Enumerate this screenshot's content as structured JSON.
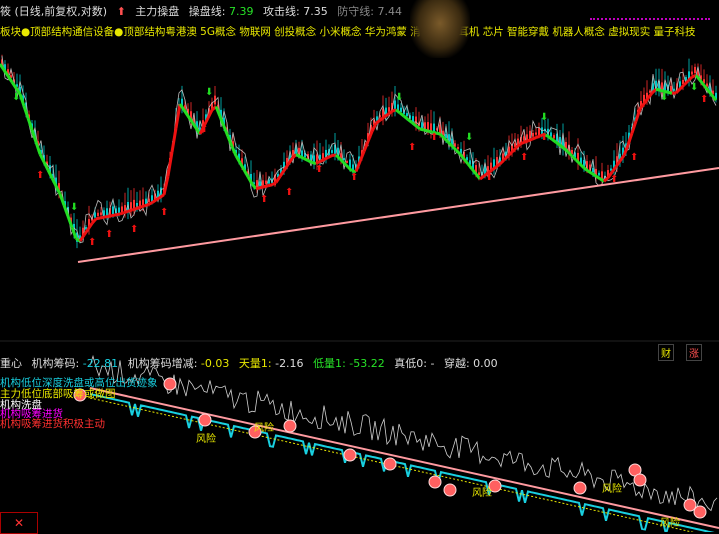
{
  "header": {
    "period": "筱 (日线,前复权,对数)",
    "main_label": "主力操盘",
    "pan_label": "操盘线",
    "pan_val": "7.39",
    "atk_label": "攻击线",
    "atk_val": "7.35",
    "def_label": "防守线",
    "def_val": "7.44"
  },
  "concepts": "板块●顶部结构通信设备●顶部结构粤港澳 5G概念 物联网 创投概念 小米概念 华为鸿蒙 消 ... 无线耳机 芯片 智能穿戴 机器人概念 虚拟现实 量子科技",
  "side_buttons": {
    "cai": "财",
    "zhang": "涨"
  },
  "indicator": {
    "name": "重心",
    "chip_label": "机构筹码",
    "chip_val": "-22.81",
    "chip_inc_label": "机构筹码增减",
    "chip_inc_val": "-0.03",
    "sky_label": "天量1",
    "sky_val": "-2.16",
    "low_label": "低量1",
    "low_val": "-53.22",
    "true_label": "真低0",
    "true_val": "-",
    "cross_label": "穿越",
    "cross_val": "0.00"
  },
  "legend": [
    {
      "text": "机构低位深度洗盘或高位出货迹象",
      "color": "#19d0e0"
    },
    {
      "text": "主力低位底部吸筹或做图",
      "color": "#e8e800"
    },
    {
      "text": "机构洗盘",
      "color": "#ffffff"
    },
    {
      "text": "机构吸筹进货",
      "color": "#ff00ff"
    },
    {
      "text": "机构吸筹进货积极主动",
      "color": "#ff3030"
    }
  ],
  "annotations": [
    "风险",
    "风险",
    "风险",
    "风险",
    "风险"
  ],
  "colors": {
    "up": "#ff3030",
    "down": "#00c8c8",
    "trend": "#ff9aa0",
    "green": "#22dd22",
    "red": "#ee1111"
  }
}
